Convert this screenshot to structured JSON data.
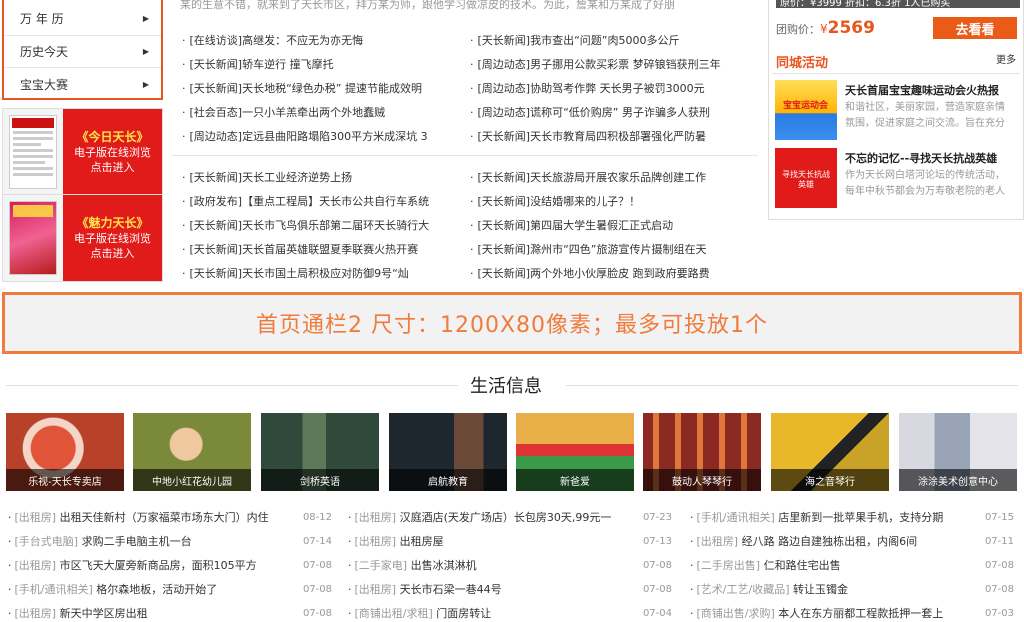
{
  "left_menu": [
    {
      "label": "万 年 历"
    },
    {
      "label": "历史今天"
    },
    {
      "label": "宝宝大赛"
    }
  ],
  "epapers": [
    {
      "title": "《今日天长》",
      "line1": "电子版在线浏览",
      "line2": "点击进入"
    },
    {
      "title": "《魅力天长》",
      "line1": "电子版在线浏览",
      "line2": "点击进入"
    }
  ],
  "intro_text": "某的生意不错，就来到了天长市区，拜万某为师，跟他学习做凉皮的技术。为此，詹某和万某成了好朋",
  "news_left_top": [
    "[在线访谈]高继发：不应无为亦无悔",
    "[天长新闻]轿车逆行 撞飞摩托",
    "[天长新闻]天长地税“绿色办税” 提速节能成效明",
    "[社会百态]一只小羊羔牵出两个外地蠢贼",
    "[周边动态]定远县曲阳路塌陷300平方米成深坑 3"
  ],
  "news_right_top": [
    "[天长新闻]我市查出“问题”肉5000多公斤",
    "[周边动态]男子挪用公款买彩票 梦碎锒铛获刑三年",
    "[周边动态]协助驾考作弊 天长男子被罚3000元",
    "[周边动态]谎称可“低价购房” 男子诈骗多人获刑",
    "[天长新闻]天长市教育局四积极部署强化严防暑"
  ],
  "news_left_bottom": [
    "[天长新闻]天长工业经济逆势上扬",
    "[政府发布]【重点工程局】天长市公共自行车系统",
    "[天长新闻]天长市飞鸟俱乐部第二届环天长骑行大",
    "[天长新闻]天长首届英雄联盟夏季联赛火热开赛",
    "[天长新闻]天长市国土局积极应对防御9号“灿"
  ],
  "news_right_bottom": [
    "[天长新闻]天长旅游局开展农家乐品牌创建工作",
    "[天长新闻]没结婚哪来的儿子？！",
    "[天长新闻]第四届大学生暑假汇正式启动",
    "[天长新闻]滁州市“四色”旅游宣传片摄制组在天",
    "[天长新闻]两个外地小伙厚脸皮 跑到政府要路费"
  ],
  "right_panel": {
    "price_line": "原价：¥3999 折扣：6.3折 1人已购买",
    "tuan_label": "团购价：",
    "currency": "¥",
    "price": "2569",
    "go_button": "去看看",
    "section_title": "同城活动",
    "more": "更多",
    "activities": [
      {
        "title": "天长首届宝宝趣味运动会火热报",
        "desc": "和谐社区，美丽家园，营造家庭亲情氛围，促进家庭之间交流。旨在充分",
        "img_text": "宝宝运动会"
      },
      {
        "title": "不忘的记忆--寻找天长抗战英雄",
        "desc": "作为天长网白塔河论坛的传统活动，每年中秋节都会为万寿敬老院的老人",
        "img_text": "寻找天长抗战英雄"
      }
    ]
  },
  "banner_text": "首页通栏2   尺寸：1200X80像素；最多可投放1个",
  "section_title": "生活信息",
  "tiles": [
    {
      "caption": "乐视-天长专卖店",
      "color": "#b8412a"
    },
    {
      "caption": "中地小红花幼儿园",
      "color": "#7a8a3a"
    },
    {
      "caption": "剑桥英语",
      "color": "#3e5a4a"
    },
    {
      "caption": "启航教育",
      "color": "#26303a"
    },
    {
      "caption": "新爸爱",
      "color": "#c77d2a"
    },
    {
      "caption": "鼓动人琴琴行",
      "color": "#8a2a22"
    },
    {
      "caption": "海之音琴行",
      "color": "#c9a227"
    },
    {
      "caption": "涂涂美术创意中心",
      "color": "#c8c8d0"
    }
  ],
  "classifieds": [
    [
      {
        "tag": "[出租房]",
        "text": " 出租天佳新村（万家福菜市场东大门）内住",
        "date": "08-12"
      },
      {
        "tag": "[手台式电脑]",
        "text": " 求购二手电脑主机一台",
        "date": "07-14"
      },
      {
        "tag": "[出租房]",
        "text": " 市区飞天大厦旁新商品房，面积105平方",
        "date": "07-08"
      },
      {
        "tag": "[手机/通讯相关]",
        "text": " 格尔森地板，活动开始了",
        "date": "07-08"
      },
      {
        "tag": "[出租房]",
        "text": " 新天中学区房出租",
        "date": "07-08"
      }
    ],
    [
      {
        "tag": "[出租房]",
        "text": " 汉庭酒店(天发广场店）长包房30天,99元一",
        "date": "07-23"
      },
      {
        "tag": "[出租房]",
        "text": " 出租房屋",
        "date": "07-13"
      },
      {
        "tag": "[二手家电]",
        "text": " 出售冰淇淋机",
        "date": "07-08"
      },
      {
        "tag": "[出租房]",
        "text": " 天长市石梁一巷44号",
        "date": "07-08"
      },
      {
        "tag": "[商铺出租/求租]",
        "text": " 门面房转让",
        "date": "07-04"
      }
    ],
    [
      {
        "tag": "[手机/通讯相关]",
        "text": " 店里新到一批苹果手机，支持分期",
        "date": "07-15"
      },
      {
        "tag": "[出租房]",
        "text": " 经八路 路边自建独栋出租，内阁6间",
        "date": "07-11"
      },
      {
        "tag": "[二手房出售]",
        "text": " 仁和路住宅出售",
        "date": "07-08"
      },
      {
        "tag": "[艺术/工艺/收藏品]",
        "text": " 转让玉镯金",
        "date": "07-08"
      },
      {
        "tag": "[商铺出售/求购]",
        "text": " 本人在东方丽都工程款抵押一套上",
        "date": "07-03"
      }
    ]
  ],
  "colors": {
    "accent": "#e8551f",
    "red": "#e11a1a",
    "banner": "#f07b3c"
  }
}
